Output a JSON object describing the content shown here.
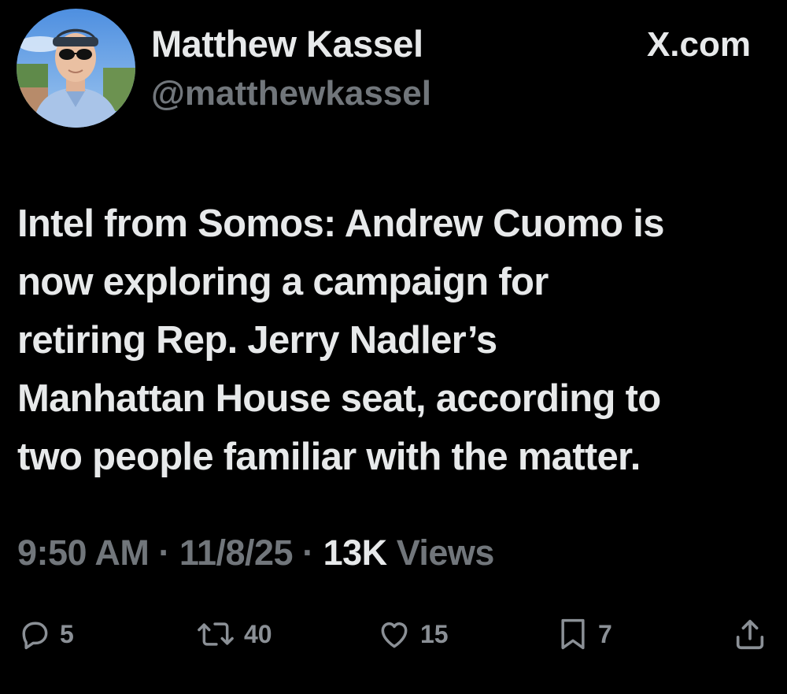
{
  "author": {
    "display_name": "Matthew Kassel",
    "handle": "@matthewkassel"
  },
  "source_label": "X.com",
  "tweet": {
    "lines": [
      "Intel from Somos: Andrew Cuomo is",
      "now exploring a campaign for",
      "retiring Rep. Jerry Nadler’s",
      "Manhattan House seat, according to",
      "two people familiar with the matter."
    ]
  },
  "meta": {
    "time": "9:50 AM",
    "separator": "·",
    "date": "11/8/25",
    "views_count": "13K",
    "views_label": "Views"
  },
  "actions": {
    "replies": "5",
    "reposts": "40",
    "likes": "15",
    "bookmarks": "7"
  },
  "icons": {
    "reply": "reply-icon",
    "repost": "repost-icon",
    "like": "heart-icon",
    "bookmark": "bookmark-icon",
    "share": "share-icon"
  },
  "colors": {
    "background": "#000000",
    "primary_text": "#e7e9ea",
    "secondary_text": "#71767b"
  }
}
